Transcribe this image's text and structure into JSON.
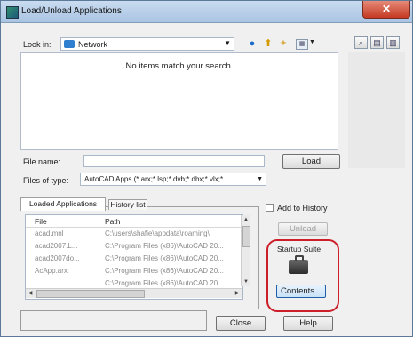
{
  "window": {
    "title": "Load/Unload Applications",
    "close_glyph": "✕"
  },
  "toolbar": {
    "look_in_label": "Look in:",
    "look_in_value": "Network",
    "icons": [
      "back-icon",
      "up-folder-icon",
      "new-folder-icon",
      "views-icon"
    ],
    "side_icons": [
      "find-icon",
      "tools-icon",
      "properties-icon"
    ]
  },
  "file_list": {
    "empty_message": "No items match your search."
  },
  "file_name": {
    "label": "File name:",
    "value": ""
  },
  "files_of_type": {
    "label": "Files of type:",
    "value": "AutoCAD Apps (*.arx;*.lsp;*.dvb;*.dbx;*.vlx;*."
  },
  "buttons": {
    "load": "Load",
    "unload": "Unload",
    "contents": "Contents...",
    "close": "Close",
    "help": "Help"
  },
  "tabs": [
    {
      "label": "Loaded Applications",
      "active": true
    },
    {
      "label": "History list",
      "active": false
    }
  ],
  "loaded_apps": {
    "columns": [
      "File",
      "Path"
    ],
    "rows": [
      {
        "file": "acad.mnl",
        "path": "C:\\users\\shafie\\appdata\\roaming\\"
      },
      {
        "file": "acad2007.L...",
        "path": "C:\\Program Files (x86)\\AutoCAD 20..."
      },
      {
        "file": "acad2007do...",
        "path": "C:\\Program Files (x86)\\AutoCAD 20..."
      },
      {
        "file": "AcApp.arx",
        "path": "C:\\Program Files (x86)\\AutoCAD 20..."
      },
      {
        "file": "",
        "path": "C:\\Program Files (x86)\\AutoCAD 20..."
      }
    ]
  },
  "add_to_history": {
    "label": "Add to History",
    "checked": false
  },
  "startup_suite": {
    "label": "Startup Suite",
    "icon": "briefcase-icon"
  },
  "colors": {
    "highlight": "#cc1f2a",
    "title_bar": "#b9d0ea",
    "close_button": "#c8442e"
  }
}
